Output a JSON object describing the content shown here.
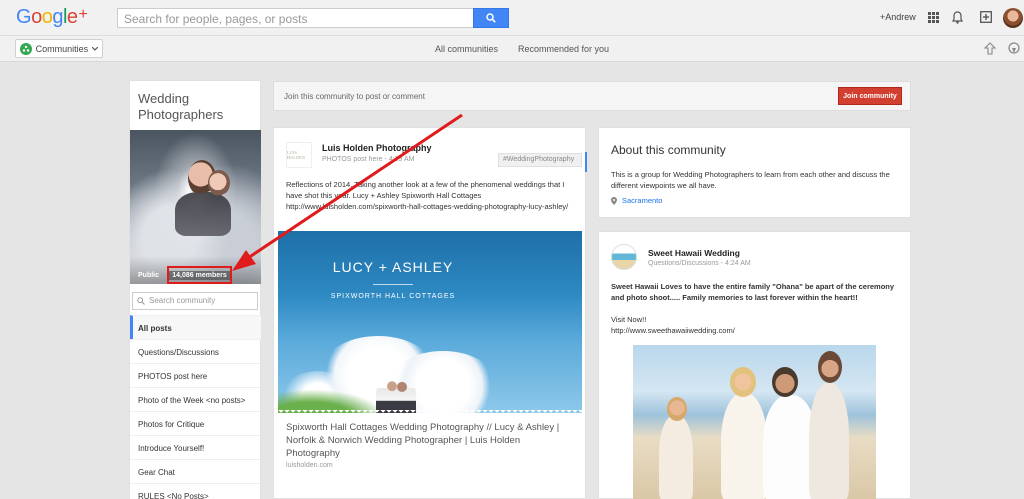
{
  "header": {
    "logo_text": "Google+",
    "search_placeholder": "Search for people, pages, or posts",
    "user_name": "+Andrew",
    "icons": [
      "search-icon",
      "apps-grid-icon",
      "notifications-bell-icon",
      "share-box-icon",
      "avatar"
    ]
  },
  "subnav": {
    "communities_label": "Communities",
    "links": [
      "All communities",
      "Recommended for you"
    ],
    "icons": [
      "hangouts-icon",
      "location-icon"
    ]
  },
  "community": {
    "title": "Wedding Photographers",
    "visibility": "Public",
    "members": "14,086 members",
    "search_placeholder": "Search community",
    "categories": [
      "All posts",
      "Questions/Discussions",
      "PHOTOS post here",
      "Photo of the Week <no posts>",
      "Photos for Critique",
      "Introduce Yourself!",
      "Gear Chat",
      "RULES <No Posts>"
    ],
    "active_category_index": 0
  },
  "join_bar": {
    "text": "Join this community to post or comment",
    "button_label": "Join community"
  },
  "post1": {
    "avatar_text": "LUIS HOLDEN",
    "author": "Luis Holden Photography",
    "category": "PHOTOS post here",
    "time": "4:19 AM",
    "meta_separator": " - ",
    "hashtag": "#WeddingPhotography",
    "body": "Reflections of 2014. Taking another look at a few of the phenomenal weddings that I have shot this year. Lucy + Ashley Spixworth Hall Cottages http://www.luisholden.com/spixworth-hall-cottages-wedding-photography-lucy-ashley/",
    "image_title": "LUCY + ASHLEY",
    "image_subtitle": "SPIXWORTH HALL COTTAGES",
    "link_title": "Spixworth Hall Cottages Wedding Photography // Lucy & Ashley | Norfolk & Norwich Wedding Photographer | Luis Holden Photography",
    "link_domain": "luisholden.com"
  },
  "about": {
    "title": "About this community",
    "description": "This is a group for Wedding Photographers to learn from each other and discuss the different viewpoints we all have.",
    "location": "Sacramento"
  },
  "post2": {
    "author": "Sweet Hawaii Wedding",
    "category": "Questions/Discussions",
    "time": "4:24 AM",
    "meta_separator": " - ",
    "body_bold": "Sweet Hawaii Loves to have the entire family \"Ohana\" be apart of the ceremony and photo shoot..... Family memories to last forever within the heart!!",
    "visit": "Visit Now!!",
    "url": "http://www.sweethawaiiwedding.com/"
  },
  "colors": {
    "accent_blue": "#4285f4",
    "join_red": "#d23f31",
    "annotation_red": "#e01b1b"
  }
}
